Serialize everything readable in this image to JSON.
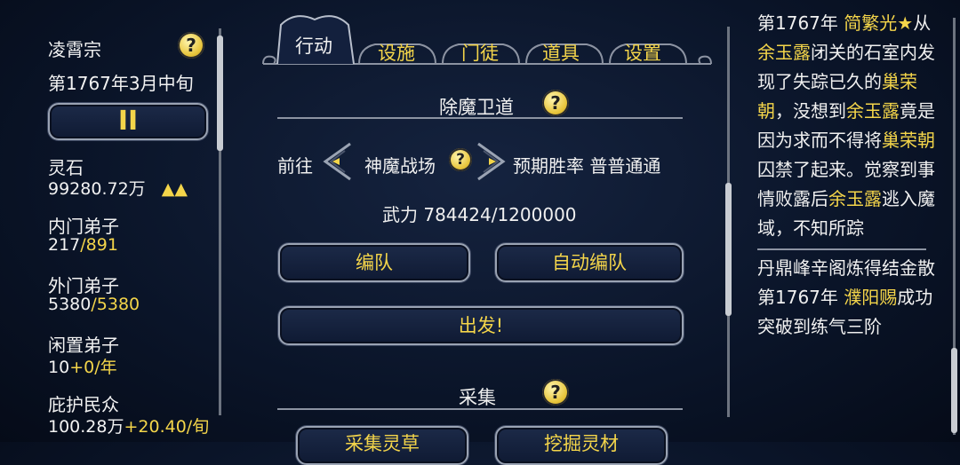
{
  "left": {
    "sect_name": "凌霄宗",
    "date": "第1767年3月中旬",
    "pause_symbol": "II",
    "stats": [
      {
        "label": "灵石",
        "value": "99280.72万",
        "extra": "▲▲"
      },
      {
        "label": "内门弟子",
        "value": "217",
        "extra": "/891"
      },
      {
        "label": "外门弟子",
        "value": "5380",
        "extra": "/5380"
      },
      {
        "label": "闲置弟子",
        "value": "10",
        "extra": "+0/年"
      },
      {
        "label": "庇护民众",
        "value": "100.28万",
        "extra": "+20.40/旬"
      }
    ]
  },
  "tabs": [
    {
      "label": "行动",
      "active": true
    },
    {
      "label": "设施"
    },
    {
      "label": "门徒"
    },
    {
      "label": "道具"
    },
    {
      "label": "设置"
    }
  ],
  "demon": {
    "title": "除魔卫道",
    "go_label": "前往",
    "location": "神魔战场",
    "win_rate_label": "预期胜率 普普通通",
    "power": "武力 784424/1200000",
    "formation_btn": "编队",
    "auto_formation_btn": "自动编队",
    "depart_btn": "出发!"
  },
  "gather": {
    "title": "采集",
    "btn1": "采集灵草",
    "btn2": "挖掘灵材"
  },
  "help_glyph": "?",
  "log": [
    {
      "parts": [
        {
          "t": "第1767年 "
        },
        {
          "t": "简繁光★",
          "gold": true
        },
        {
          "t": "从"
        },
        {
          "t": "余玉露",
          "gold": true
        },
        {
          "t": "闭关的石室内发现了失踪已久的"
        },
        {
          "t": "巢荣朝",
          "gold": true
        },
        {
          "t": "，没想到"
        },
        {
          "t": "余玉露",
          "gold": true
        },
        {
          "t": "竟是因为求而不得将"
        },
        {
          "t": "巢荣朝",
          "gold": true
        },
        {
          "t": "囚禁了起来。觉察到事情败露后"
        },
        {
          "t": "余玉露",
          "gold": true
        },
        {
          "t": "逃入魔域，不知所踪"
        }
      ]
    },
    {
      "parts": [
        {
          "t": "丹鼎峰辛阁炼得结金散"
        }
      ]
    },
    {
      "parts": [
        {
          "t": "第1767年 "
        },
        {
          "t": "濮阳赐",
          "gold": true
        },
        {
          "t": "成功突破到练气三阶"
        }
      ]
    }
  ],
  "colors": {
    "gold": "#f4d54a",
    "bg": "#0a1428",
    "border": "#9aa3b3"
  }
}
